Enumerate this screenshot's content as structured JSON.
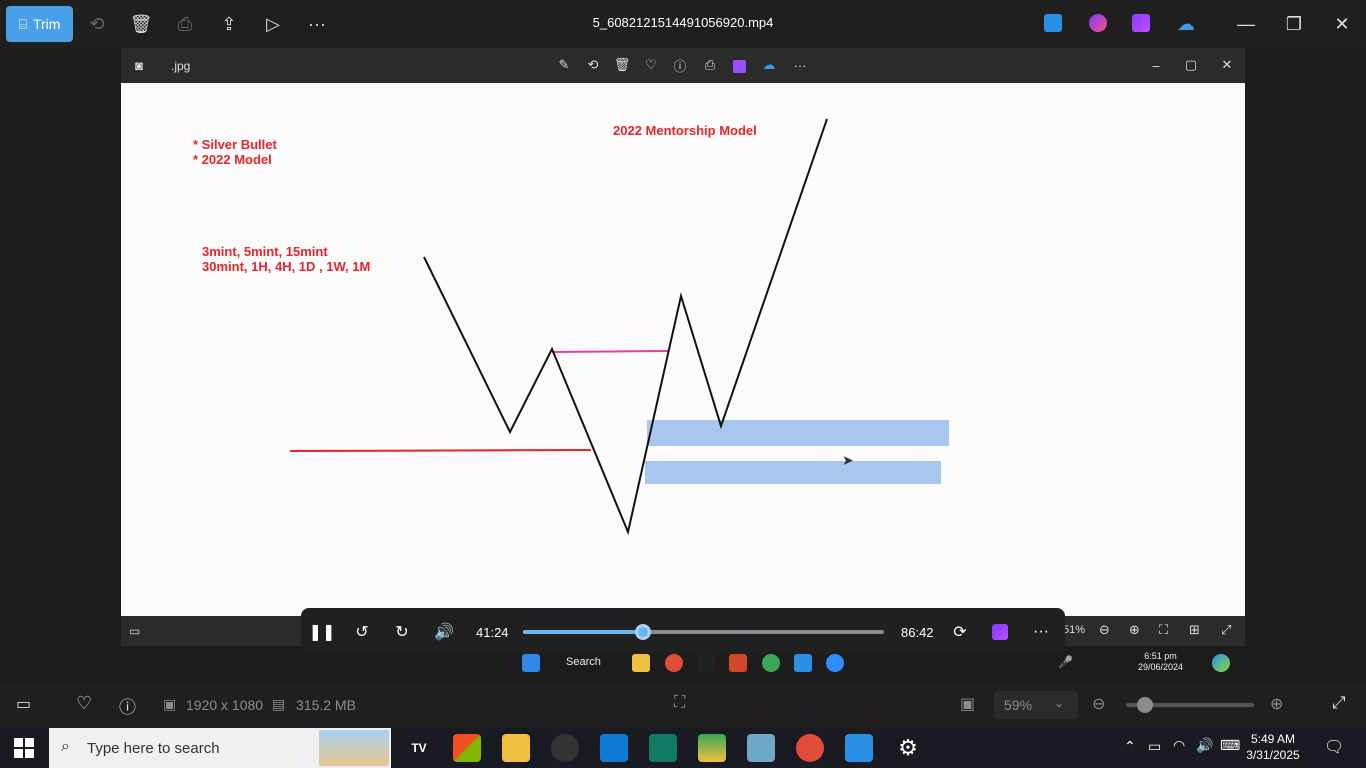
{
  "app": {
    "title": "5_6082121514491056920.mp4",
    "trim_label": "Trim"
  },
  "inner_window": {
    "title": ".jpg"
  },
  "slide": {
    "notes_line1": "* Silver Bullet",
    "notes_line2": "* 2022 Model",
    "heading": "2022 Mentorship Model",
    "timeframes_line1": "3mint, 5mint, 15mint",
    "timeframes_line2": "30mint, 1H, 4H, 1D , 1W, 1M"
  },
  "player": {
    "current_time": "41:24",
    "total_time": "86:42",
    "progress": 0.333,
    "zoom_partial": "51%"
  },
  "inner_taskbar": {
    "search_label": "Search",
    "time": "6:51 pm",
    "date": "29/06/2024"
  },
  "status_bar": {
    "resolution": "1920 x 1080",
    "file_size": "315.2 MB",
    "zoom": "59%",
    "zoom_slider_value": 0.1
  },
  "taskbar": {
    "search_placeholder": "Type here to search",
    "time": "5:49 AM",
    "date": "3/31/2025"
  },
  "colors": {
    "accent": "#4aa0e6",
    "slide_red": "#e8252a",
    "highlight_blue": "#a9c7ee",
    "pink_line": "#e040a0"
  }
}
